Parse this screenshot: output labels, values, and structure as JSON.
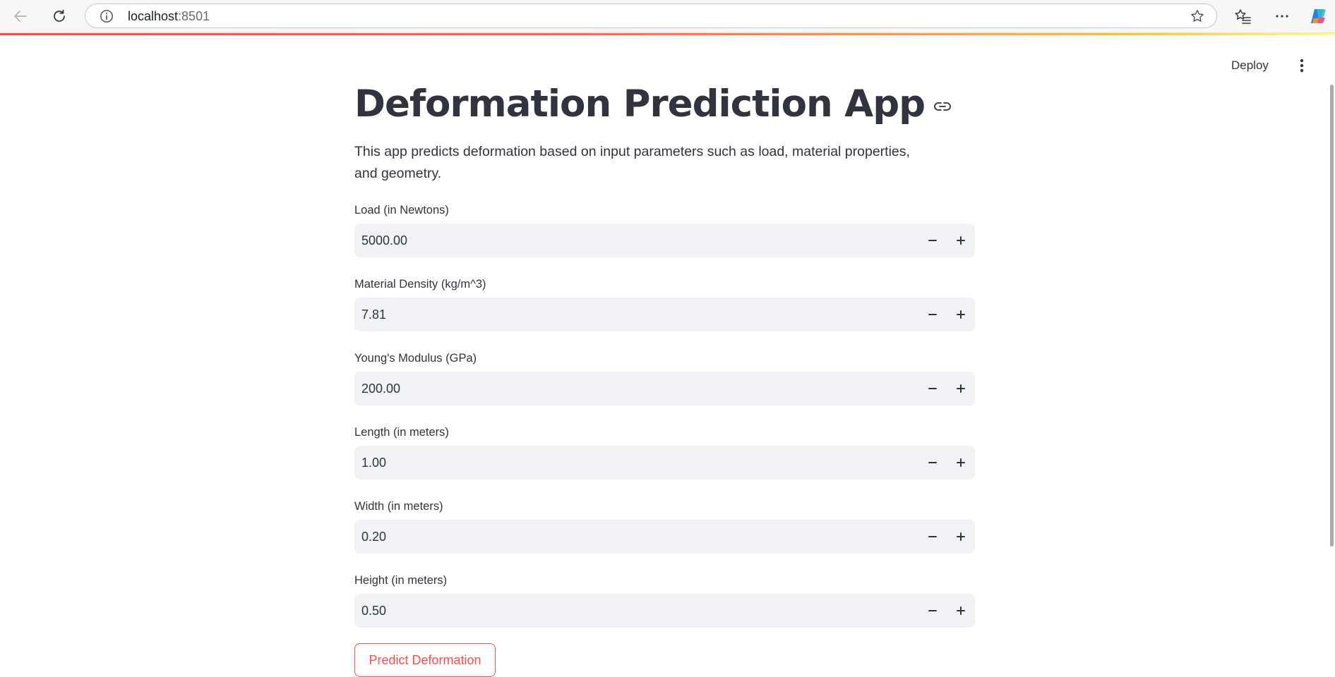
{
  "browser": {
    "url_host": "localhost",
    "url_port": ":8501"
  },
  "header": {
    "deploy_label": "Deploy"
  },
  "app": {
    "title": "Deformation Prediction App",
    "description": "This app predicts deformation based on input parameters such as load, material properties, and geometry.",
    "fields": [
      {
        "label": "Load (in Newtons)",
        "value": "5000.00"
      },
      {
        "label": "Material Density (kg/m^3)",
        "value": "7.81"
      },
      {
        "label": "Young's Modulus (GPa)",
        "value": "200.00"
      },
      {
        "label": "Length (in meters)",
        "value": "1.00"
      },
      {
        "label": "Width (in meters)",
        "value": "0.20"
      },
      {
        "label": "Height (in meters)",
        "value": "0.50"
      }
    ],
    "predict_label": "Predict Deformation"
  },
  "colors": {
    "primary": "#ff4b4b",
    "text": "#31333f",
    "input_background": "#f0f2f6"
  },
  "icons": [
    "back-arrow-icon",
    "refresh-icon",
    "info-icon",
    "star-icon",
    "favorites-icon",
    "more-icon",
    "copilot-icon",
    "link-icon",
    "menu-icon",
    "minus-icon",
    "plus-icon"
  ]
}
